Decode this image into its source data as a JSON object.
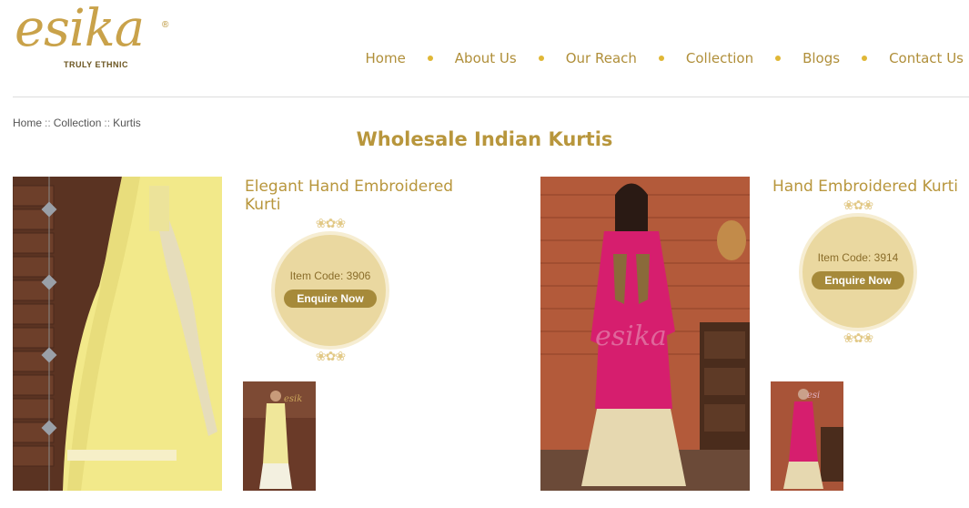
{
  "brand": {
    "logo_text": "esika",
    "registered": "®",
    "tagline": "TRULY ETHNIC"
  },
  "nav": {
    "items": [
      "Home",
      "About Us",
      "Our Reach",
      "Collection",
      "Blogs",
      "Contact Us"
    ]
  },
  "breadcrumb": {
    "items": [
      "Home",
      "Collection",
      "Kurtis"
    ],
    "separator": "::"
  },
  "page": {
    "title": "Wholesale Indian Kurtis"
  },
  "products": [
    {
      "name_line1": "Elegant Hand Embroidered",
      "name_line2": "Kurti",
      "item_code": "Item Code: 3906",
      "enquire_label": "Enquire Now"
    },
    {
      "name_line1": "Hand Embroidered Kurti",
      "name_line2": "",
      "item_code": "Item Code: 3914",
      "enquire_label": "Enquire Now"
    }
  ],
  "colors": {
    "gold": "#b8963c",
    "badge": "#ead8a0",
    "button": "#a68a3a",
    "dot": "#e0b736"
  }
}
